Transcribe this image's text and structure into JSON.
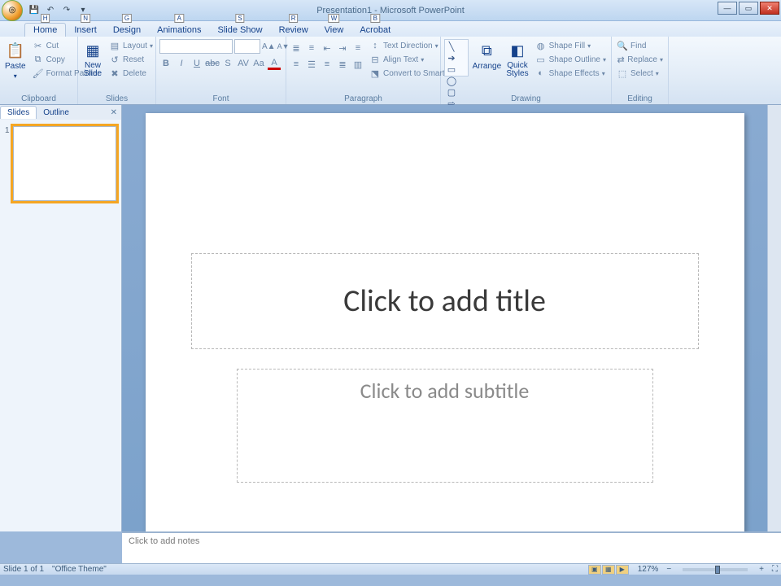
{
  "app": {
    "title": "Presentation1 - Microsoft PowerPoint"
  },
  "keytips": {
    "office": "",
    "h": "H",
    "n": "N",
    "g": "G",
    "a": "A",
    "s": "S",
    "r": "R",
    "w": "W",
    "b": "B"
  },
  "tabs": [
    "Home",
    "Insert",
    "Design",
    "Animations",
    "Slide Show",
    "Review",
    "View",
    "Acrobat"
  ],
  "active_tab": "Home",
  "ribbon": {
    "clipboard": {
      "label": "Clipboard",
      "paste": "Paste",
      "cut": "Cut",
      "copy": "Copy",
      "format_painter": "Format Painter"
    },
    "slides": {
      "label": "Slides",
      "new_slide": "New\nSlide",
      "layout": "Layout",
      "reset": "Reset",
      "delete": "Delete"
    },
    "font": {
      "label": "Font",
      "name": "",
      "size": ""
    },
    "paragraph": {
      "label": "Paragraph",
      "text_direction": "Text Direction",
      "align_text": "Align Text",
      "smartart": "Convert to SmartArt"
    },
    "drawing": {
      "label": "Drawing",
      "arrange": "Arrange",
      "quick_styles": "Quick\nStyles",
      "shape_fill": "Shape Fill",
      "shape_outline": "Shape Outline",
      "shape_effects": "Shape Effects"
    },
    "editing": {
      "label": "Editing",
      "find": "Find",
      "replace": "Replace",
      "select": "Select"
    }
  },
  "panel": {
    "tab_slides": "Slides",
    "tab_outline": "Outline",
    "slide_num": "1"
  },
  "slide": {
    "title_placeholder": "Click to add title",
    "subtitle_placeholder": "Click to add subtitle"
  },
  "notes": {
    "placeholder": "Click to add notes"
  },
  "status": {
    "slide_info": "Slide 1 of 1",
    "theme": "\"Office Theme\"",
    "zoom": "127%"
  }
}
